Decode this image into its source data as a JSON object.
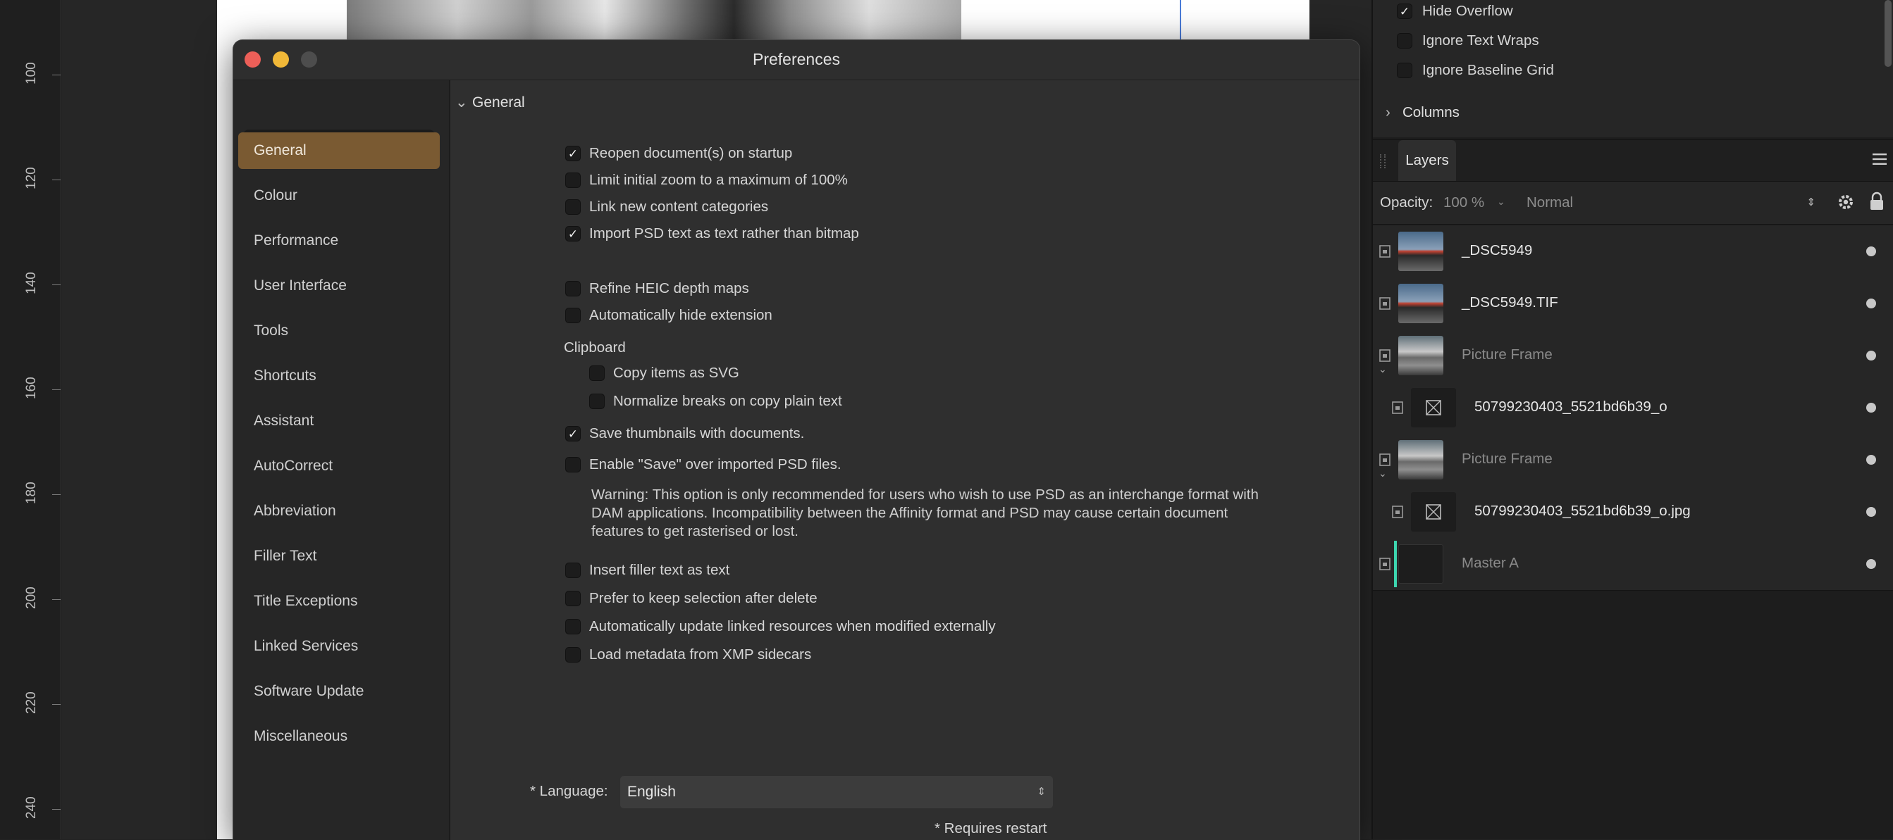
{
  "ruler": {
    "labels": [
      "100",
      "120",
      "140",
      "160",
      "180",
      "200",
      "220",
      "240"
    ]
  },
  "window": {
    "title": "Preferences",
    "search": {
      "placeholder": "",
      "value": ""
    },
    "nav": [
      {
        "label": "General",
        "active": true
      },
      {
        "label": "Colour"
      },
      {
        "label": "Performance"
      },
      {
        "label": "User Interface"
      },
      {
        "label": "Tools"
      },
      {
        "label": "Shortcuts"
      },
      {
        "label": "Assistant"
      },
      {
        "label": "AutoCorrect"
      },
      {
        "label": "Abbreviation"
      },
      {
        "label": "Filler Text"
      },
      {
        "label": "Title Exceptions"
      },
      {
        "label": "Linked Services"
      },
      {
        "label": "Software Update"
      },
      {
        "label": "Miscellaneous"
      }
    ],
    "general": {
      "heading": "General",
      "options": [
        {
          "label": "Reopen document(s) on startup",
          "checked": true
        },
        {
          "label": "Limit initial zoom to a maximum of 100%",
          "checked": false
        },
        {
          "label": "Link new content categories",
          "checked": false
        },
        {
          "label": "Import PSD text as text rather than bitmap",
          "checked": true
        },
        {
          "label": "Refine HEIC depth maps",
          "checked": false
        },
        {
          "label": "Automatically hide extension",
          "checked": false
        },
        {
          "label": "Copy items as SVG",
          "checked": false
        },
        {
          "label": "Normalize breaks on copy plain text",
          "checked": false
        },
        {
          "label": "Save thumbnails with documents.",
          "checked": true
        },
        {
          "label": "Enable \"Save\" over imported PSD files.",
          "checked": false
        },
        {
          "label": "Insert filler text as text",
          "checked": false
        },
        {
          "label": "Prefer to keep selection after delete",
          "checked": false
        },
        {
          "label": "Automatically update linked resources when modified externally",
          "checked": false
        },
        {
          "label": "Load metadata from XMP sidecars",
          "checked": false
        }
      ],
      "clipboard_label": "Clipboard",
      "warning": "Warning: This option is only recommended for users who wish to use PSD as an interchange format with DAM applications. Incompatibility between the Affinity format and PSD may cause certain document features to get rasterised or lost.",
      "language_label": "* Language:",
      "language_value": "English",
      "restart_note": "* Requires restart"
    }
  },
  "panel": {
    "text_frame_options": [
      {
        "label": "Hide Overflow",
        "checked": true
      },
      {
        "label": "Ignore Text Wraps",
        "checked": false
      },
      {
        "label": "Ignore Baseline Grid",
        "checked": false
      }
    ],
    "columns_label": "Columns",
    "layers_tab": "Layers",
    "opacity_label": "Opacity:",
    "opacity_value": "100 %",
    "blend_mode": "Normal",
    "layers": [
      {
        "name": "_DSC5949",
        "dim": false
      },
      {
        "name": "_DSC5949.TIF",
        "dim": false
      },
      {
        "name": "Picture Frame",
        "dim": true
      },
      {
        "name": "50799230403_5521bd6b39_o",
        "dim": false
      },
      {
        "name": "Picture Frame",
        "dim": true
      },
      {
        "name": "50799230403_5521bd6b39_o.jpg",
        "dim": false
      },
      {
        "name": "Master A",
        "dim": true
      }
    ]
  }
}
